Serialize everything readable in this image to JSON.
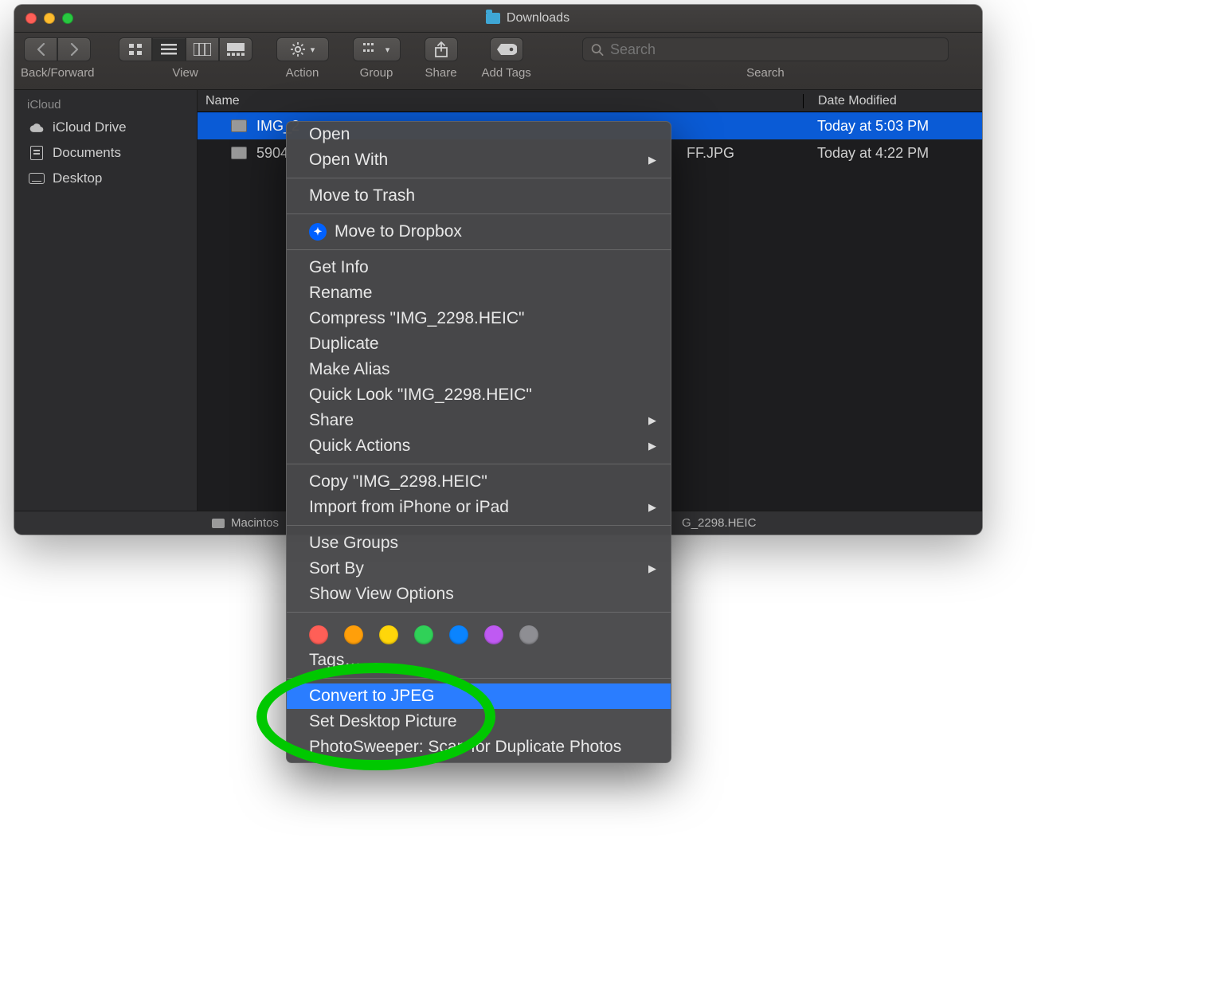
{
  "window": {
    "title": "Downloads"
  },
  "toolbar": {
    "back_forward_label": "Back/Forward",
    "view_label": "View",
    "action_label": "Action",
    "group_label": "Group",
    "share_label": "Share",
    "addtags_label": "Add Tags",
    "search_label": "Search",
    "search_placeholder": "Search"
  },
  "sidebar": {
    "section": "iCloud",
    "items": [
      {
        "label": "iCloud Drive"
      },
      {
        "label": "Documents"
      },
      {
        "label": "Desktop"
      }
    ]
  },
  "columns": {
    "name": "Name",
    "date": "Date Modified"
  },
  "files": [
    {
      "name": "IMG_2",
      "date": "Today at 5:03 PM"
    },
    {
      "name_prefix": "5904",
      "name_suffix": "FF.JPG",
      "date": "Today at 4:22 PM"
    }
  ],
  "pathbar": {
    "disk": "Macintos",
    "tail": "G_2298.HEIC"
  },
  "context_menu": {
    "open": "Open",
    "open_with": "Open With",
    "trash": "Move to Trash",
    "dropbox": "Move to Dropbox",
    "get_info": "Get Info",
    "rename": "Rename",
    "compress": "Compress \"IMG_2298.HEIC\"",
    "duplicate": "Duplicate",
    "alias": "Make Alias",
    "quicklook": "Quick Look \"IMG_2298.HEIC\"",
    "share": "Share",
    "quickactions": "Quick Actions",
    "copy": "Copy \"IMG_2298.HEIC\"",
    "import": "Import from iPhone or iPad",
    "usegroups": "Use Groups",
    "sortby": "Sort By",
    "viewoptions": "Show View Options",
    "tags": "Tags…",
    "convert": "Convert to JPEG",
    "setdesktop": "Set Desktop Picture",
    "photosweeper": "PhotoSweeper: Scan for Duplicate Photos"
  }
}
